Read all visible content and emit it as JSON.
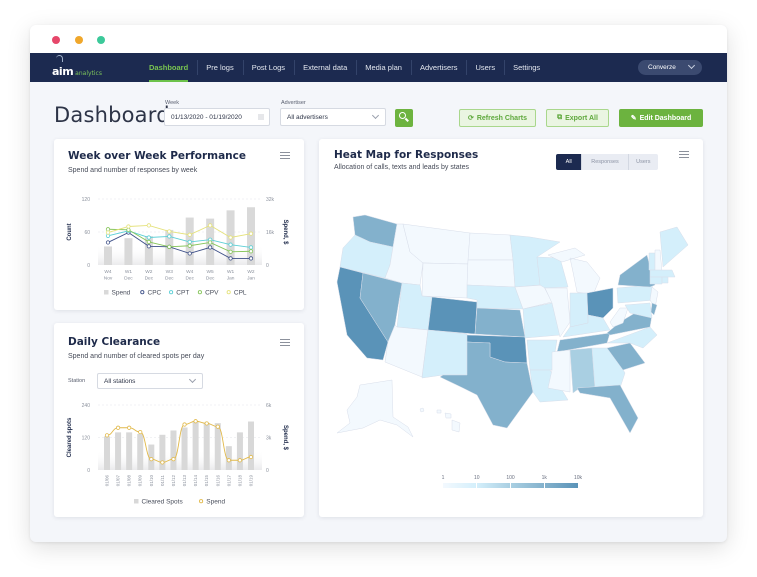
{
  "window": {
    "dots": [
      "#e6476a",
      "#f0a72b",
      "#3cc99a"
    ]
  },
  "nav": {
    "logo_main": "aim",
    "logo_sub": "analytics",
    "items": [
      {
        "label": "Dashboard",
        "active": true
      },
      {
        "label": "Pre logs",
        "active": false
      },
      {
        "label": "Post Logs",
        "active": false
      },
      {
        "label": "External data",
        "active": false
      },
      {
        "label": "Media plan",
        "active": false
      },
      {
        "label": "Advertisers",
        "active": false
      },
      {
        "label": "Users",
        "active": false
      },
      {
        "label": "Settings",
        "active": false
      }
    ],
    "account": "Converze"
  },
  "page": {
    "title": "Dashboard"
  },
  "filters": {
    "week_label": "Week",
    "week_value": "01/13/2020 - 01/19/2020",
    "advertiser_label": "Advertiser",
    "advertiser_value": "All advertisers"
  },
  "actions": {
    "refresh": "Refresh Charts",
    "refresh_icon": "⟳",
    "export": "Export All",
    "export_icon": "⧉",
    "edit": "Edit Dashboard",
    "edit_icon": "✎"
  },
  "cards": {
    "wow": {
      "title": "Week over Week Performance",
      "subtitle": "Spend and number of responses by week"
    },
    "daily": {
      "title": "Daily Clearance",
      "subtitle": "Spend and number of cleared spots per day",
      "station_label": "Station",
      "station_value": "All stations"
    },
    "heatmap": {
      "title": "Heat Map for Responses",
      "subtitle": "Allocation of calls, texts and leads by states",
      "tabs": [
        {
          "label": "All",
          "active": true
        },
        {
          "label": "Responses",
          "active": false
        },
        {
          "label": "Users",
          "active": false
        }
      ]
    }
  },
  "colors": {
    "navy": "#1c2a50",
    "accent_green": "#6cb33f",
    "bar_grey": "#d8d8d8"
  },
  "chart_data": [
    {
      "id": "wow",
      "type": "bar",
      "title": "Week over Week Performance",
      "categories": [
        "W4 Nov",
        "W1 Dec",
        "W2 Dec",
        "W3 Dec",
        "W4 Dec",
        "W5 Dec",
        "W1 Jan",
        "W2 Jan"
      ],
      "ylabel": "Count",
      "y2label": "Spend, $",
      "ylim": [
        0,
        120
      ],
      "y2lim": [
        0,
        32000
      ],
      "yticks": [
        "0",
        "60",
        "120"
      ],
      "y2ticks": [
        "0",
        "16k",
        "32k"
      ],
      "grid": true,
      "legend": "bottom",
      "series": [
        {
          "name": "Spend",
          "render": "bar",
          "axis": "right",
          "color": "#d9d9d9",
          "values": [
            9000,
            13000,
            14000,
            17000,
            23000,
            22500,
            26500,
            28000
          ]
        },
        {
          "name": "CPC",
          "render": "line",
          "axis": "left",
          "color": "#3e5088",
          "values": [
            41,
            59,
            34,
            33,
            21,
            32,
            12,
            12
          ]
        },
        {
          "name": "CPT",
          "render": "line",
          "axis": "left",
          "color": "#5ccfd6",
          "values": [
            53,
            62,
            50,
            52,
            42,
            46,
            37,
            32
          ]
        },
        {
          "name": "CPV",
          "render": "line",
          "axis": "left",
          "color": "#86c55a",
          "values": [
            65,
            64,
            42,
            33,
            35,
            41,
            24,
            25
          ]
        },
        {
          "name": "CPL",
          "render": "line",
          "axis": "left",
          "color": "#e5e27c",
          "values": [
            59,
            70,
            72,
            61,
            55,
            72,
            50,
            57
          ]
        }
      ]
    },
    {
      "id": "daily",
      "type": "bar",
      "title": "Daily Clearance",
      "categories": [
        "01/06",
        "01/07",
        "01/08",
        "01/09",
        "01/10",
        "01/11",
        "01/12",
        "01/13",
        "01/14",
        "01/15",
        "01/16",
        "01/17",
        "01/18",
        "01/19"
      ],
      "ylabel": "Cleared spots",
      "y2label": "Spend, $",
      "ylim": [
        0,
        240
      ],
      "y2lim": [
        0,
        6000
      ],
      "yticks": [
        "0",
        "120",
        "240"
      ],
      "y2ticks": [
        "0",
        "3k",
        "6k"
      ],
      "grid": true,
      "legend": "bottom",
      "series": [
        {
          "name": "Cleared Spots",
          "render": "bar",
          "axis": "left",
          "color": "#d8d8d8",
          "values": [
            124,
            139,
            139,
            133,
            94,
            130,
            146,
            157,
            179,
            173,
            173,
            88,
            139,
            179
          ]
        },
        {
          "name": "Spend",
          "render": "line",
          "axis": "right",
          "color": "#e1b94b",
          "values": [
            3200,
            3900,
            3900,
            3500,
            1000,
            700,
            1000,
            4200,
            4500,
            4300,
            4000,
            900,
            900,
            1200
          ]
        }
      ]
    },
    {
      "id": "heatmap",
      "type": "heatmap",
      "title": "Heat Map for Responses",
      "legend_ticks": [
        "1",
        "10",
        "100",
        "1k",
        "10k"
      ],
      "scale_colors": [
        "#f3f9fe",
        "#d4effb",
        "#a9cfe2",
        "#83b1cc",
        "#5a93b8"
      ],
      "legend": "bottom-center",
      "states": {
        "CA": "10k",
        "CO": "10k",
        "OK": "10k",
        "OH": "10k",
        "WA": "1k",
        "NV": "1k",
        "KS": "1k",
        "TX": "1k",
        "TN": "1k",
        "VA": "1k",
        "SC": "1k",
        "FL": "1k",
        "NY": "1k",
        "DE": "1k",
        "AL": "100",
        "OR": "10",
        "UT": "10",
        "NM": "10",
        "NE": "10",
        "MN": "10",
        "WI": "10",
        "MO": "10",
        "AR": "10",
        "LA": "10",
        "IN": "10",
        "KY": "10",
        "NC": "10",
        "GA": "10",
        "PA": "10",
        "ME": "10",
        "VT": "10",
        "MA": "10",
        "CT": "10",
        "RI": "10",
        "MD": "10",
        "MT": "1",
        "ID": "1",
        "WY": "1",
        "ND": "1",
        "SD": "1",
        "IA": "1",
        "IL": "1",
        "MI": "1",
        "MS": "1",
        "AZ": "1",
        "WV": "1",
        "NH": "1",
        "NJ": "1",
        "AK": "1",
        "HI": "1"
      }
    }
  ]
}
